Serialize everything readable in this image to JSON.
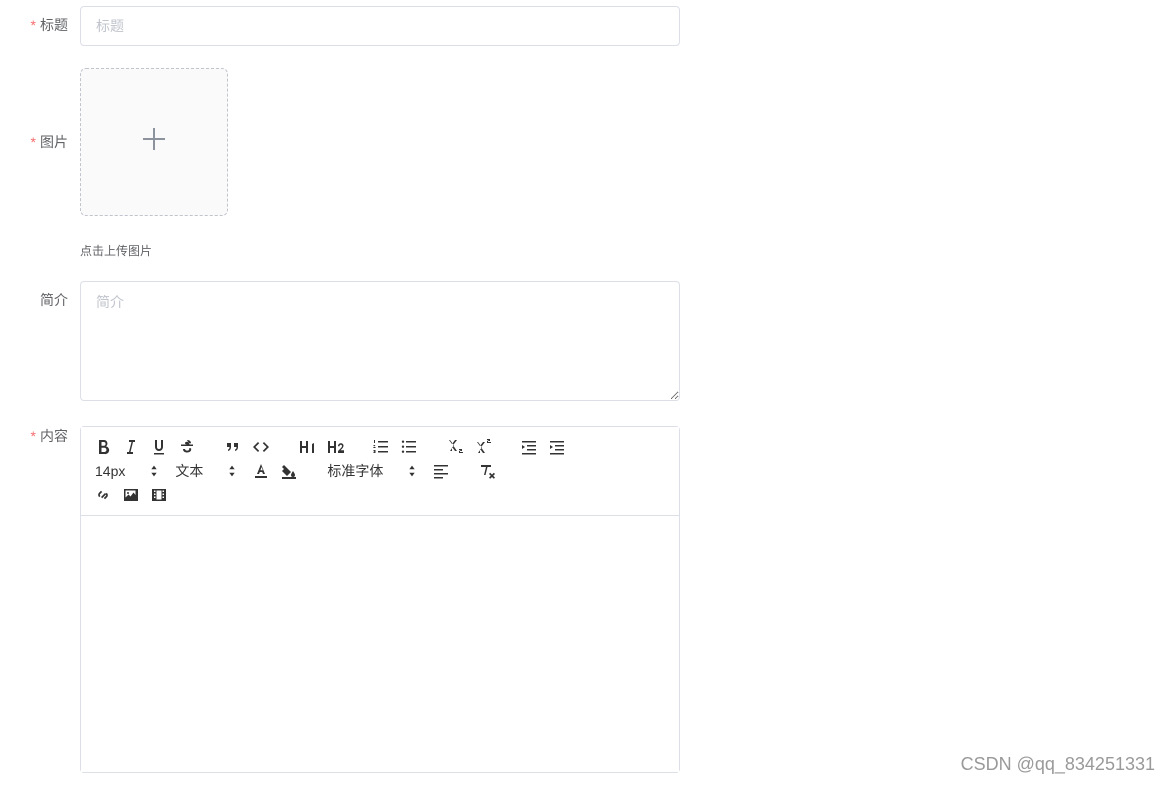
{
  "form": {
    "title": {
      "label": "标题",
      "placeholder": "标题",
      "value": ""
    },
    "image": {
      "label": "图片",
      "hint": "点击上传图片"
    },
    "summary": {
      "label": "简介",
      "placeholder": "简介",
      "value": ""
    },
    "content": {
      "label": "内容"
    }
  },
  "editor": {
    "fontSize": "14px",
    "textType": "文本",
    "fontFamily": "标准字体"
  },
  "watermark": "CSDN @qq_834251331"
}
